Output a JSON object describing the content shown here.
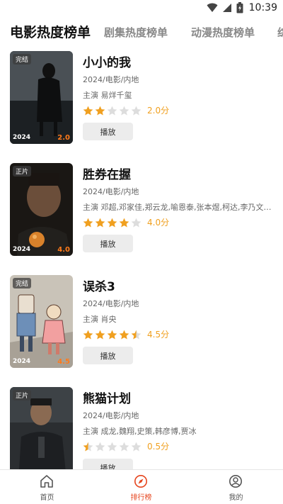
{
  "status_bar": {
    "time": "10:39"
  },
  "tabs": [
    {
      "label": "电影热度榜单",
      "active": true
    },
    {
      "label": "剧集热度榜单",
      "active": false
    },
    {
      "label": "动漫热度榜单",
      "active": false
    },
    {
      "label": "综",
      "active": false
    }
  ],
  "movies": [
    {
      "title": "小小的我",
      "badge": "完结",
      "year": "2024",
      "poster_score": "2.0",
      "meta": "2024/电影/内地",
      "cast": "主演 易烊千玺",
      "rating": 2.0,
      "score": "2.0分",
      "button": "播放"
    },
    {
      "title": "胜券在握",
      "badge": "正片",
      "year": "2024",
      "poster_score": "4.0",
      "meta": "2024/电影/内地",
      "cast": "主演 邓超,邓家佳,郑云龙,喻恩泰,张本煜,柯达,李乃文,杨...",
      "rating": 4.0,
      "score": "4.0分",
      "button": "播放"
    },
    {
      "title": "误杀3",
      "badge": "完结",
      "year": "2024",
      "poster_score": "4.5",
      "meta": "2024/电影/内地",
      "cast": "主演 肖央",
      "rating": 4.5,
      "score": "4.5分",
      "button": "播放"
    },
    {
      "title": "熊猫计划",
      "badge": "正片",
      "year": "",
      "poster_score": "",
      "meta": "2024/电影/内地",
      "cast": "主演 成龙,魏翔,史策,韩彦博,贾冰",
      "rating": 0.5,
      "score": "0.5分",
      "button": "播放"
    }
  ],
  "bottom_nav": [
    {
      "label": "首页",
      "icon": "home-icon",
      "active": false
    },
    {
      "label": "排行榜",
      "icon": "compass-icon",
      "active": true
    },
    {
      "label": "我的",
      "icon": "user-icon",
      "active": false
    }
  ],
  "colors": {
    "star": "#f0a020",
    "star_empty": "#dddddd",
    "accent": "#e6451e",
    "poster_score": "#ff7a1a"
  }
}
